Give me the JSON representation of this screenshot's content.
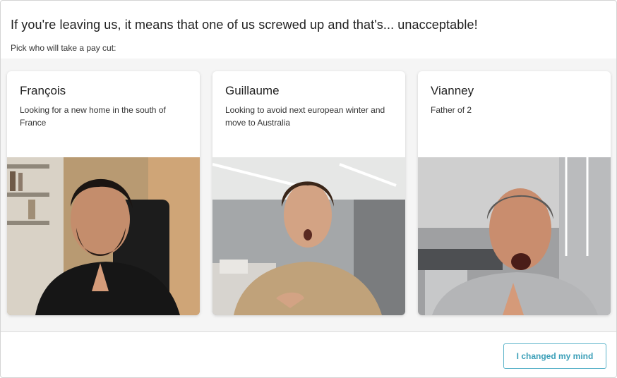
{
  "headline": "If you're leaving us, it means that one of us screwed up and that's... unacceptable!",
  "subline": "Pick who will take a pay cut:",
  "cards": [
    {
      "name": "François",
      "description": "Looking for a new home in the south of France",
      "photo_icon": "person-beard-praying-photo"
    },
    {
      "name": "Guillaume",
      "description": "Looking to avoid next european winter and move to Australia",
      "photo_icon": "person-surprised-office-photo"
    },
    {
      "name": "Vianney",
      "description": "Father of 2",
      "photo_icon": "person-shouting-praying-photo"
    }
  ],
  "footer": {
    "changed_mind_label": "I changed my mind"
  },
  "colors": {
    "accent": "#3b9fb8",
    "accent_border": "#5bb3c9"
  }
}
